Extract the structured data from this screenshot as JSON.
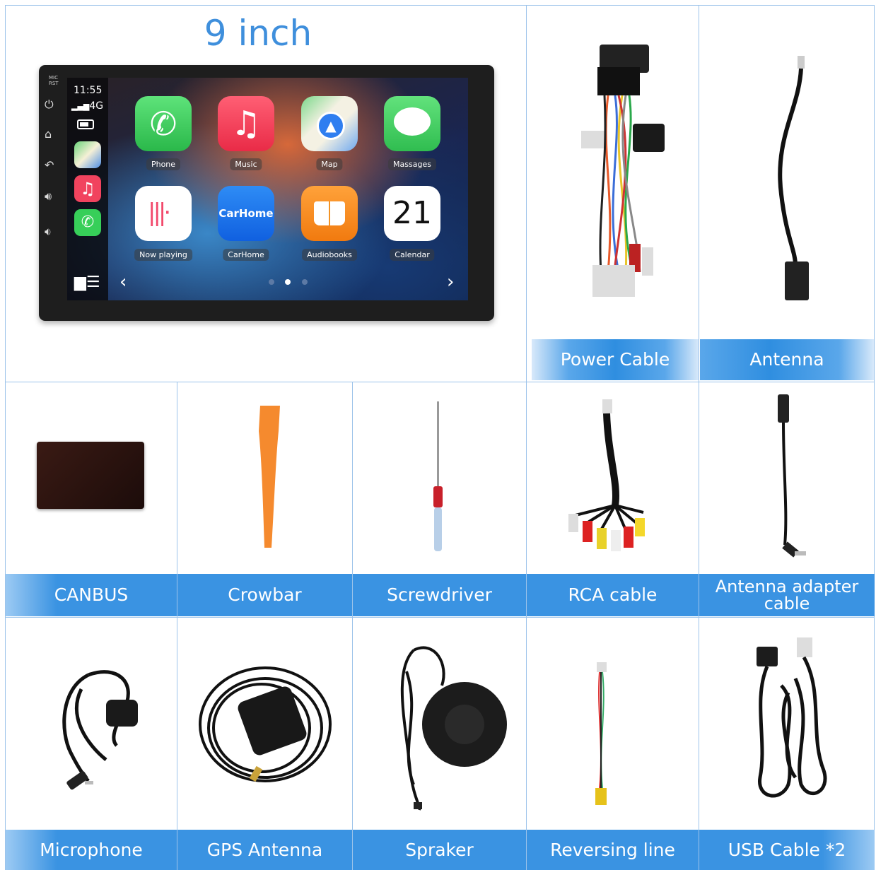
{
  "header": {
    "title": "9 inch"
  },
  "device": {
    "time": "11:55",
    "network": "4G",
    "side_labels": [
      "MIC",
      "RST"
    ],
    "apps": [
      {
        "label": "Phone",
        "icon": "phone-icon"
      },
      {
        "label": "Music",
        "icon": "music-icon"
      },
      {
        "label": "Map",
        "icon": "map-icon"
      },
      {
        "label": "Massages",
        "icon": "messages-icon"
      },
      {
        "label": "Now playing",
        "icon": "now-playing-icon"
      },
      {
        "label": "CarHome",
        "icon_text": "CarHome"
      },
      {
        "label": "Audiobooks",
        "icon": "book-icon"
      },
      {
        "label": "Calendar",
        "icon_text": "21"
      }
    ]
  },
  "accessories": {
    "power_cable": "Power Cable",
    "antenna": "Antenna",
    "canbus": "CANBUS",
    "crowbar": "Crowbar",
    "screwdriver": "Screwdriver",
    "rca_cable": "RCA cable",
    "antenna_adapter": "Antenna adapter cable",
    "microphone": "Microphone",
    "gps_antenna": "GPS Antenna",
    "speaker": "Spraker",
    "reversing_line": "Reversing line",
    "usb_cable": "USB Cable *2"
  },
  "colors": {
    "accent": "#3a93e2",
    "title": "#3f8fdc",
    "border": "#9cc3ea"
  }
}
